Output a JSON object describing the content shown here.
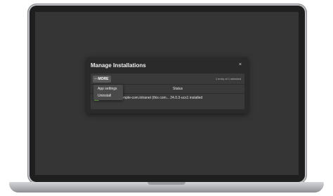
{
  "modal": {
    "title": "Manage Installations",
    "close_icon": "close-icon",
    "close_glyph": "×"
  },
  "grid": {
    "more_button": {
      "icon": "more-dots-icon",
      "dots": "⋯",
      "label": "MORE"
    },
    "selection_info": "1 entry of 1 selected",
    "columns": {
      "status": "Status"
    },
    "rows": [
      {
        "selected": true,
        "name": "ucs-7559.example-com.intranet (this com...",
        "version": "24.0.3-ucs1",
        "status": "installed"
      }
    ]
  },
  "dropdown": {
    "items": [
      {
        "label": "App settings"
      },
      {
        "label": "Uninstall"
      }
    ]
  },
  "colors": {
    "selected_check": "#7dc94a",
    "modal_bg": "#2a2a2a",
    "screen_bg": "#353535"
  }
}
